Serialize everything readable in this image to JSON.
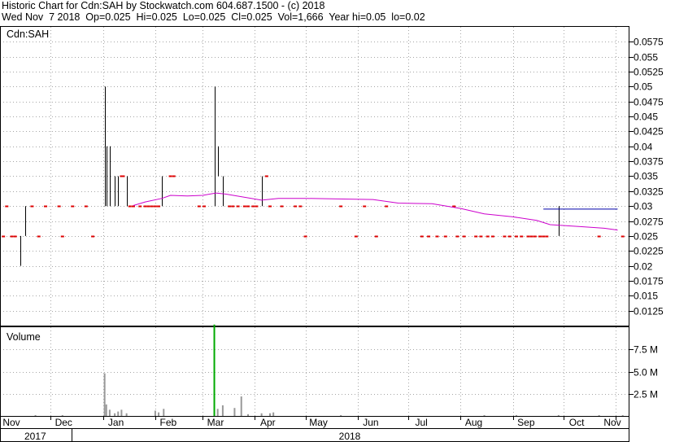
{
  "header": {
    "line1": "Historic Chart for Cdn:SAH by Stockwatch.com 604.687.1500 - (c) 2018",
    "line2": "Wed Nov  7 2018  Op=0.025  Hi=0.025  Lo=0.025  Cl=0.025  Vol=1,666  Year hi=0.05  lo=0.02"
  },
  "colors": {
    "bar": "#000000",
    "flat_day": "#dd0000",
    "moving_average": "#cc00cc",
    "blue_line": "#0000aa",
    "volume_bar": "#999999",
    "volume_spike": "#00aa00",
    "grid": "#000000"
  },
  "chart_data": [
    {
      "type": "line",
      "title": "Cdn:SAH",
      "subtype": "ohlc-price",
      "ylim": [
        0.01,
        0.06
      ],
      "y_ticks": [
        "0.0575",
        "0.055",
        "0.0525",
        "0.05",
        "0.0475",
        "0.045",
        "0.0425",
        "0.04",
        "0.0375",
        "0.035",
        "0.0325",
        "0.03",
        "0.0275",
        "0.025",
        "0.0225",
        "0.02",
        "0.0175",
        "0.015",
        "0.0125"
      ],
      "x_tick_labels": [
        "Nov",
        "Dec",
        "Jan",
        "Feb",
        "Mar",
        "Apr",
        "May",
        "Jun",
        "Jul",
        "Aug",
        "Sep",
        "Oct",
        "Nov"
      ],
      "years": [
        "2017",
        "2018"
      ],
      "ohlc_bars": [
        {
          "d": "2017-11-07",
          "lo": 0.025,
          "hi": 0.025
        },
        {
          "d": "2017-11-13",
          "lo": 0.02,
          "hi": 0.025
        },
        {
          "d": "2017-11-16",
          "lo": 0.025,
          "hi": 0.03
        },
        {
          "d": "2018-01-02",
          "lo": 0.03,
          "hi": 0.05
        },
        {
          "d": "2018-01-03",
          "lo": 0.03,
          "hi": 0.04
        },
        {
          "d": "2018-01-05",
          "lo": 0.03,
          "hi": 0.04
        },
        {
          "d": "2018-01-08",
          "lo": 0.03,
          "hi": 0.035
        },
        {
          "d": "2018-01-10",
          "lo": 0.03,
          "hi": 0.035
        },
        {
          "d": "2018-01-15",
          "lo": 0.03,
          "hi": 0.035
        },
        {
          "d": "2018-02-05",
          "lo": 0.03,
          "hi": 0.035
        },
        {
          "d": "2018-03-08",
          "lo": 0.03,
          "hi": 0.05
        },
        {
          "d": "2018-03-10",
          "lo": 0.035,
          "hi": 0.04
        },
        {
          "d": "2018-03-13",
          "lo": 0.03,
          "hi": 0.035
        },
        {
          "d": "2018-04-05",
          "lo": 0.03,
          "hi": 0.035
        },
        {
          "d": "2018-09-28",
          "lo": 0.025,
          "hi": 0.03
        }
      ],
      "flat_days": [
        {
          "d": "2017-11-03",
          "v": 0.025
        },
        {
          "d": "2017-11-05",
          "v": 0.03
        },
        {
          "d": "2017-11-08",
          "v": 0.025
        },
        {
          "d": "2017-11-10",
          "v": 0.025
        },
        {
          "d": "2017-11-20",
          "v": 0.03
        },
        {
          "d": "2017-11-24",
          "v": 0.025
        },
        {
          "d": "2017-11-28",
          "v": 0.03
        },
        {
          "d": "2017-12-06",
          "v": 0.03
        },
        {
          "d": "2017-12-08",
          "v": 0.025
        },
        {
          "d": "2017-12-14",
          "v": 0.03
        },
        {
          "d": "2017-12-22",
          "v": 0.03
        },
        {
          "d": "2017-12-26",
          "v": 0.025
        },
        {
          "d": "2018-01-12",
          "v": 0.035
        },
        {
          "d": "2018-01-13",
          "v": 0.035
        },
        {
          "d": "2018-01-17",
          "v": 0.03
        },
        {
          "d": "2018-01-19",
          "v": 0.03
        },
        {
          "d": "2018-01-23",
          "v": 0.03
        },
        {
          "d": "2018-01-26",
          "v": 0.03
        },
        {
          "d": "2018-01-28",
          "v": 0.03
        },
        {
          "d": "2018-01-30",
          "v": 0.03
        },
        {
          "d": "2018-02-01",
          "v": 0.03
        },
        {
          "d": "2018-02-03",
          "v": 0.03
        },
        {
          "d": "2018-02-10",
          "v": 0.035
        },
        {
          "d": "2018-02-12",
          "v": 0.035
        },
        {
          "d": "2018-02-27",
          "v": 0.03
        },
        {
          "d": "2018-03-02",
          "v": 0.03
        },
        {
          "d": "2018-03-17",
          "v": 0.03
        },
        {
          "d": "2018-03-19",
          "v": 0.03
        },
        {
          "d": "2018-03-22",
          "v": 0.03
        },
        {
          "d": "2018-03-26",
          "v": 0.03
        },
        {
          "d": "2018-03-28",
          "v": 0.03
        },
        {
          "d": "2018-03-31",
          "v": 0.03
        },
        {
          "d": "2018-04-02",
          "v": 0.03
        },
        {
          "d": "2018-04-08",
          "v": 0.035
        },
        {
          "d": "2018-04-10",
          "v": 0.03
        },
        {
          "d": "2018-04-17",
          "v": 0.03
        },
        {
          "d": "2018-04-25",
          "v": 0.03
        },
        {
          "d": "2018-04-28",
          "v": 0.03
        },
        {
          "d": "2018-05-01",
          "v": 0.025
        },
        {
          "d": "2018-05-22",
          "v": 0.03
        },
        {
          "d": "2018-05-31",
          "v": 0.025
        },
        {
          "d": "2018-06-05",
          "v": 0.03
        },
        {
          "d": "2018-06-12",
          "v": 0.025
        },
        {
          "d": "2018-06-18",
          "v": 0.03
        },
        {
          "d": "2018-07-09",
          "v": 0.025
        },
        {
          "d": "2018-07-13",
          "v": 0.025
        },
        {
          "d": "2018-07-18",
          "v": 0.025
        },
        {
          "d": "2018-07-23",
          "v": 0.025
        },
        {
          "d": "2018-07-28",
          "v": 0.03
        },
        {
          "d": "2018-07-30",
          "v": 0.025
        },
        {
          "d": "2018-08-03",
          "v": 0.025
        },
        {
          "d": "2018-08-10",
          "v": 0.025
        },
        {
          "d": "2018-08-13",
          "v": 0.025
        },
        {
          "d": "2018-08-17",
          "v": 0.025
        },
        {
          "d": "2018-08-20",
          "v": 0.025
        },
        {
          "d": "2018-08-27",
          "v": 0.025
        },
        {
          "d": "2018-08-30",
          "v": 0.025
        },
        {
          "d": "2018-09-03",
          "v": 0.025
        },
        {
          "d": "2018-09-06",
          "v": 0.025
        },
        {
          "d": "2018-09-10",
          "v": 0.025
        },
        {
          "d": "2018-09-12",
          "v": 0.025
        },
        {
          "d": "2018-09-14",
          "v": 0.025
        },
        {
          "d": "2018-09-17",
          "v": 0.025
        },
        {
          "d": "2018-09-19",
          "v": 0.025
        },
        {
          "d": "2018-09-21",
          "v": 0.025
        },
        {
          "d": "2018-10-22",
          "v": 0.025
        },
        {
          "d": "2018-11-05",
          "v": 0.025
        }
      ],
      "moving_average": [
        {
          "d": "2018-01-19",
          "v": 0.0301
        },
        {
          "d": "2018-01-26",
          "v": 0.0307
        },
        {
          "d": "2018-02-05",
          "v": 0.0313
        },
        {
          "d": "2018-02-10",
          "v": 0.0318
        },
        {
          "d": "2018-02-20",
          "v": 0.0317
        },
        {
          "d": "2018-03-01",
          "v": 0.0318
        },
        {
          "d": "2018-03-09",
          "v": 0.0322
        },
        {
          "d": "2018-03-15",
          "v": 0.032
        },
        {
          "d": "2018-04-05",
          "v": 0.031
        },
        {
          "d": "2018-04-15",
          "v": 0.0313
        },
        {
          "d": "2018-05-01",
          "v": 0.0313
        },
        {
          "d": "2018-05-20",
          "v": 0.0312
        },
        {
          "d": "2018-06-10",
          "v": 0.0311
        },
        {
          "d": "2018-06-25",
          "v": 0.0305
        },
        {
          "d": "2018-07-15",
          "v": 0.0304
        },
        {
          "d": "2018-08-01",
          "v": 0.0296
        },
        {
          "d": "2018-08-15",
          "v": 0.0287
        },
        {
          "d": "2018-09-01",
          "v": 0.0282
        },
        {
          "d": "2018-09-15",
          "v": 0.0276
        },
        {
          "d": "2018-09-23",
          "v": 0.0269
        },
        {
          "d": "2018-10-10",
          "v": 0.0266
        },
        {
          "d": "2018-10-25",
          "v": 0.0263
        },
        {
          "d": "2018-11-02",
          "v": 0.026
        }
      ],
      "reference_line": {
        "from": "2018-09-19",
        "to": "2018-11-02",
        "v": 0.0295
      }
    },
    {
      "type": "bar",
      "title": "Volume",
      "ylim": [
        0,
        10
      ],
      "y_ticks": [
        "7.5 M",
        "5.0 M",
        "2.5 M"
      ],
      "volume_bars": [
        {
          "d": "2017-11-22",
          "v": 0.05
        },
        {
          "d": "2017-12-08",
          "v": 0.03
        },
        {
          "d": "2018-01-02",
          "v": 4.8
        },
        {
          "d": "2018-01-03",
          "v": 1.3
        },
        {
          "d": "2018-01-05",
          "v": 0.7
        },
        {
          "d": "2018-01-08",
          "v": 0.3
        },
        {
          "d": "2018-01-10",
          "v": 0.5
        },
        {
          "d": "2018-01-12",
          "v": 0.7
        },
        {
          "d": "2018-01-15",
          "v": 0.3
        },
        {
          "d": "2018-02-01",
          "v": 0.6
        },
        {
          "d": "2018-02-03",
          "v": 0.4
        },
        {
          "d": "2018-02-06",
          "v": 0.8
        },
        {
          "d": "2018-03-08",
          "v": 10.3
        },
        {
          "d": "2018-03-10",
          "v": 0.8
        },
        {
          "d": "2018-03-13",
          "v": 1.2
        },
        {
          "d": "2018-03-20",
          "v": 0.9
        },
        {
          "d": "2018-03-24",
          "v": 2.2
        },
        {
          "d": "2018-03-28",
          "v": 0.2
        },
        {
          "d": "2018-04-05",
          "v": 0.3
        },
        {
          "d": "2018-04-10",
          "v": 0.3
        },
        {
          "d": "2018-04-12",
          "v": 0.4
        },
        {
          "d": "2018-05-22",
          "v": 0.05
        },
        {
          "d": "2018-08-15",
          "v": 0.05
        },
        {
          "d": "2018-09-03",
          "v": 0.05
        },
        {
          "d": "2018-09-28",
          "v": 0.1
        },
        {
          "d": "2018-10-22",
          "v": 0.05
        },
        {
          "d": "2018-11-05",
          "v": 0.05
        }
      ]
    }
  ]
}
